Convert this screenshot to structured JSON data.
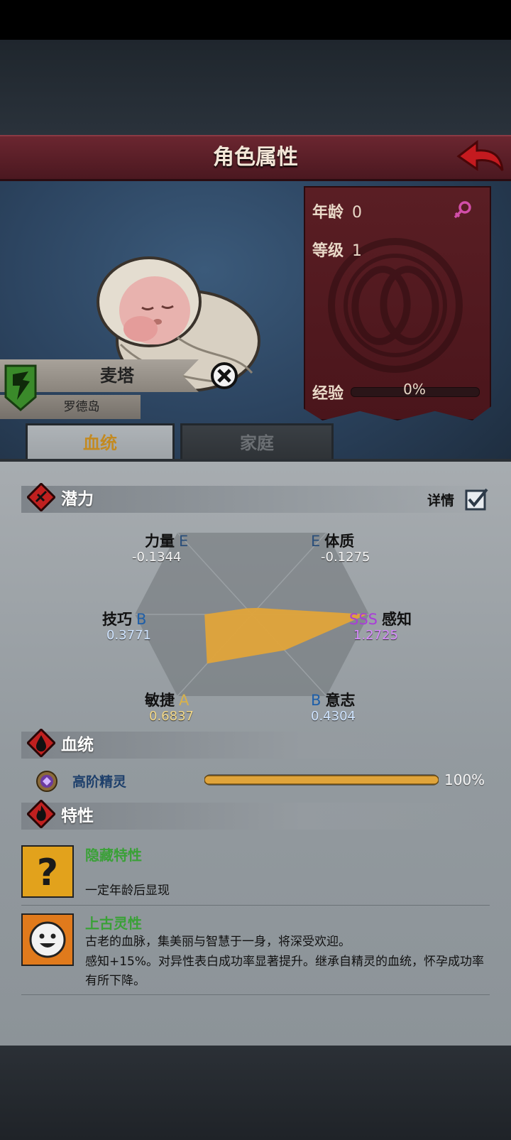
{
  "header": {
    "title": "角色属性",
    "back_icon": "red-back-arrow-icon"
  },
  "character": {
    "name": "麦塔",
    "place": "罗德岛",
    "portrait": "swaddled-baby"
  },
  "stats": {
    "age_label": "年龄",
    "age_value": "0",
    "level_label": "等级",
    "level_value": "1",
    "exp_label": "经验",
    "exp_value": "0%",
    "exp_fraction": 0,
    "gender_icon": "female-symbol-icon"
  },
  "tabs": [
    {
      "label": "血统",
      "active": true
    },
    {
      "label": "家庭",
      "active": false
    }
  ],
  "potential": {
    "section_label": "潜力",
    "detail_label": "详情",
    "detail_checked": true,
    "axes": {
      "strength": {
        "name": "力量",
        "grade": "E",
        "value": "-0.1344"
      },
      "constitution": {
        "name": "体质",
        "grade": "E",
        "value": "-0.1275"
      },
      "skill": {
        "name": "技巧",
        "grade": "B",
        "value": "0.3771"
      },
      "perception": {
        "name": "感知",
        "grade": "SSS",
        "value": "1.2725"
      },
      "agility": {
        "name": "敏捷",
        "grade": "A",
        "value": "0.6837"
      },
      "will": {
        "name": "意志",
        "grade": "B",
        "value": "0.4304"
      }
    },
    "colors": {
      "E": "#2b4f7a",
      "B": "#1f5fa8",
      "A": "#d8b24a",
      "SSS": "#a93dd8",
      "fill": "#e0a43a"
    }
  },
  "bloodline": {
    "section_label": "血统",
    "name": "高阶精灵",
    "percent": "100%",
    "fraction": 1.0
  },
  "traits": {
    "section_label": "特性",
    "items": [
      {
        "name": "隐藏特性",
        "desc": "一定年龄后显现",
        "icon": "question-mark-icon"
      },
      {
        "name": "上古灵性",
        "desc1": "古老的血脉，集美丽与智慧于一身，将深受欢迎。",
        "desc2": "感知+15%。对异性表白成功率显著提升。继承自精灵的血统，怀孕成功率有所下降。",
        "icon": "smiling-face-icon"
      }
    ]
  }
}
